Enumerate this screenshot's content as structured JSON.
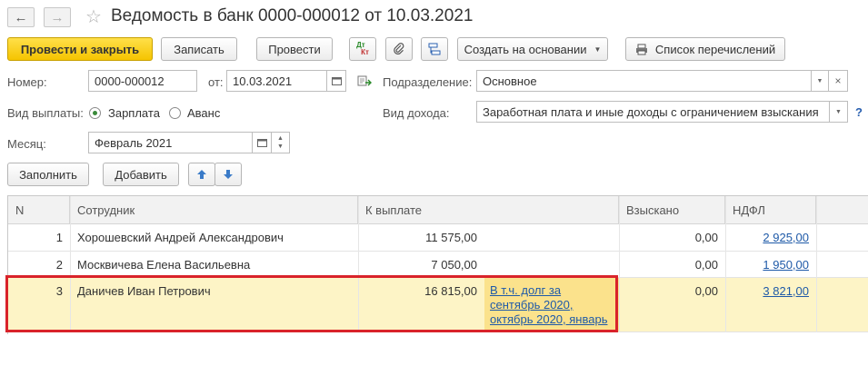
{
  "window": {
    "title": "Ведомость в банк 0000-000012 от 10.03.2021"
  },
  "toolbar": {
    "post_close": "Провести и закрыть",
    "save": "Записать",
    "post": "Провести",
    "dt_kt_top": "Дт",
    "dt_kt_bottom": "Кт",
    "create_based": "Создать на основании",
    "transfer_list": "Список перечислений"
  },
  "form": {
    "number_label": "Номер:",
    "number_value": "0000-000012",
    "date_label": "от:",
    "date_value": "10.03.2021",
    "division_label": "Подразделение:",
    "division_value": "Основное",
    "payment_type_label": "Вид выплаты:",
    "payment_options": [
      "Зарплата",
      "Аванс"
    ],
    "payment_selected": "Зарплата",
    "income_type_label": "Вид дохода:",
    "income_type_value": "Заработная плата и иные доходы с ограничением взыскания",
    "help_mark": "?",
    "month_label": "Месяц:",
    "month_value": "Февраль 2021"
  },
  "table_toolbar": {
    "fill": "Заполнить",
    "add": "Добавить"
  },
  "table": {
    "columns": [
      "N",
      "Сотрудник",
      "К выплате",
      "Взыскано",
      "НДФЛ"
    ],
    "rows": [
      {
        "n": "1",
        "employee": "Хорошевский Андрей Александрович",
        "payout": "11 575,00",
        "note": "",
        "collected": "0,00",
        "ndfl": "2 925,00"
      },
      {
        "n": "2",
        "employee": "Москвичева Елена Васильевна",
        "payout": "7 050,00",
        "note": "",
        "collected": "0,00",
        "ndfl": "1 950,00"
      },
      {
        "n": "3",
        "employee": "Даничев Иван Петрович",
        "payout": "16 815,00",
        "note": "В т.ч. долг за сентябрь 2020, октябрь 2020, январь",
        "note_lines": [
          "В т.ч. долг за",
          "сентябрь 2020,",
          "октябрь 2020, январь"
        ],
        "collected": "0,00",
        "ndfl": "3 821,00"
      }
    ],
    "selected_row": 3
  },
  "colors": {
    "primary_button": "#f5c400",
    "selected_row": "#fdf4c6",
    "highlight_frame": "#d9232a",
    "link": "#1f5aa8"
  }
}
